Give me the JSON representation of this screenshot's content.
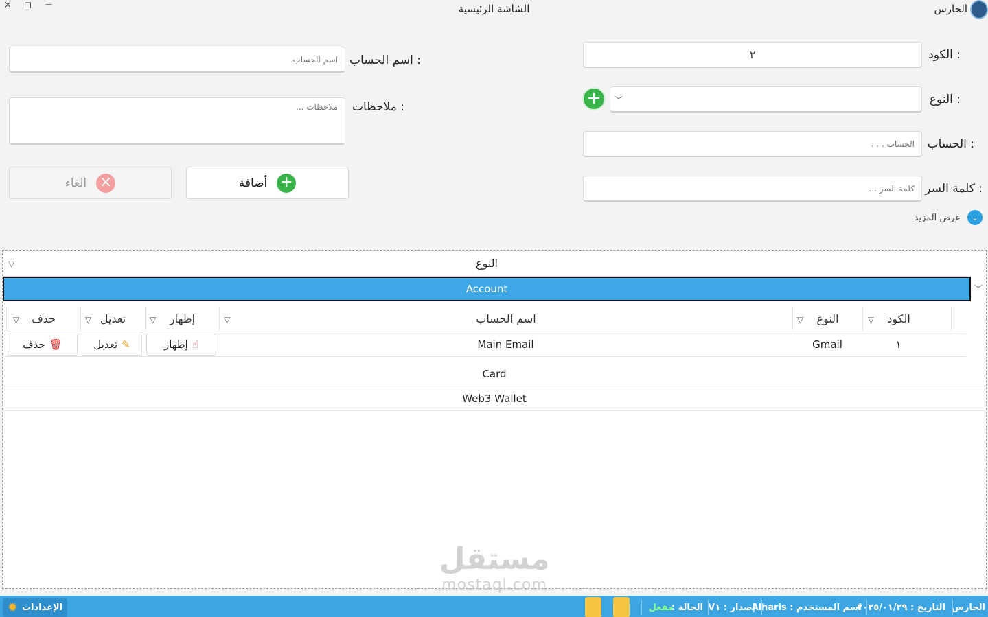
{
  "window": {
    "app_name": "الحارس",
    "title": "الشاشة الرئيسية",
    "close_glyph": "×",
    "restore_glyph": "❐",
    "minimize_glyph": "—"
  },
  "form": {
    "code_label": "الكود :",
    "code_value": "٢",
    "type_label": "النوع :",
    "account_label": "الحساب :",
    "account_placeholder": "الحساب . . .",
    "password_label": "كلمة السر :",
    "password_placeholder": "كلمة السر ...",
    "account_name_label": "اسم الحساب :",
    "account_name_placeholder": "اسم الحساب",
    "notes_label": "ملاحظات :",
    "notes_placeholder": "ملاحظات ...",
    "add_label": "أضافة",
    "cancel_label": "الغاء",
    "show_more_label": "عرض المزيد"
  },
  "grid": {
    "group_column": "النوع",
    "groups": [
      "Account",
      "Card",
      "Web3 Wallet"
    ],
    "columns": {
      "code": "الكود",
      "type": "النوع",
      "account_name": "اسم الحساب",
      "show": "إظهار",
      "edit": "تعديل",
      "delete": "حذف"
    },
    "rows": [
      {
        "code": "١",
        "type": "Gmail",
        "account_name": "Main Email",
        "show": "إظهار",
        "edit": "تعديل",
        "delete": "حذف"
      }
    ]
  },
  "watermark": {
    "text": "مستقل",
    "sub": "mostaql.com"
  },
  "status": {
    "app_name": "الحارس",
    "date": "التاريخ : ٢٠٢٥/٠١/٢٩",
    "user": "اسم المستخدم : Alharis",
    "version": "إصدار : V١",
    "state_label": "الحالة :",
    "state_value": "مفعل",
    "settings_label": "الإعدادات"
  },
  "colors": {
    "accent": "#3da6e2",
    "add_green": "#3ab44a",
    "cancel_red": "#f08080",
    "selected_row": "#3ea8e6"
  },
  "icons": {
    "add": "plus-circle-icon",
    "cancel": "x-circle-icon",
    "filter": "filter-icon",
    "show": "hand-pointer-icon",
    "edit": "pencil-icon",
    "delete": "trash-icon",
    "settings": "gear-icon"
  }
}
